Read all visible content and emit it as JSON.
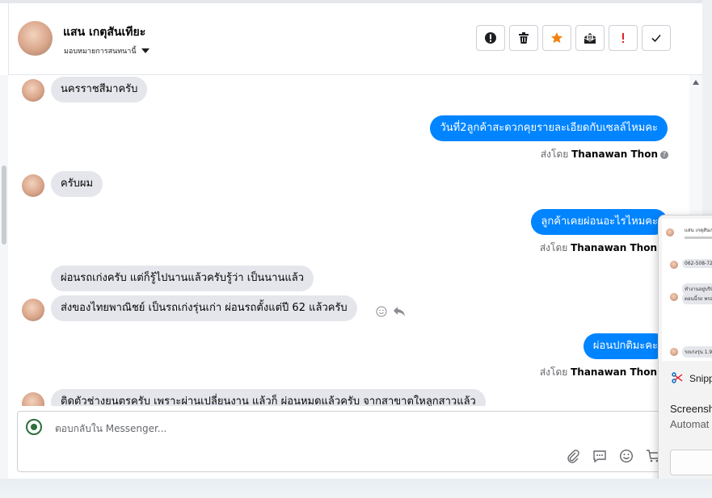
{
  "header": {
    "contact_name": "แสน เกตุสันเทียะ",
    "assign_label": "มอบหมายการสนทนานี้",
    "actions": [
      {
        "name": "mark-spam-button",
        "icon": "exclamation-circle-icon"
      },
      {
        "name": "delete-button",
        "icon": "trash-icon"
      },
      {
        "name": "star-button",
        "icon": "star-icon"
      },
      {
        "name": "mark-unread-button",
        "icon": "envelope-open-icon"
      },
      {
        "name": "follow-up-button",
        "icon": "exclamation-icon"
      },
      {
        "name": "mark-done-button",
        "icon": "checkmark-icon"
      }
    ]
  },
  "messages": [
    {
      "dir": "in",
      "text": "นครราชสีมาครับ"
    },
    {
      "dir": "out",
      "text": "วันที่2ลูกค้าสะดวกคุยรายละเอียดกับเซลล์ไหมคะ",
      "sent_prefix": "ส่งโดย",
      "sender": "Thanawan Thon"
    },
    {
      "dir": "in",
      "text": "ครับผม"
    },
    {
      "dir": "out",
      "text": "ลูกค้าเคยผ่อนอะไรไหมคะ",
      "sent_prefix": "ส่งโดย",
      "sender": "Thanawan Thon"
    },
    {
      "dir": "in",
      "text": "ผ่อนรถเก่งครับ แต่ก็รู้ไปนานแล้วครับรู้ว่า เป็นนานแล้ว"
    },
    {
      "dir": "in",
      "text": "ส่งของไทยพาณิชย์ เป็นรถเก่งรุ่นเก่า ผ่อนรถตั้งแต่ปี 62 แล้วครับ"
    },
    {
      "dir": "out",
      "text": "ผ่อนปกติมะคะ",
      "sent_prefix": "ส่งโดย",
      "sender": "Thanawan Thon"
    },
    {
      "dir": "in",
      "text": "ติดตัวช่างยนตรครับ เพราะผ่านเปลี่ยนงาน แล้วก็ ผ่อนหมดแล้วครับ จากสาขาตใหลูกสาวแล้ว"
    }
  ],
  "composer": {
    "placeholder": "ตอบกลับใน Messenger..."
  },
  "snip_popup": {
    "app_name": "Snipp",
    "line1": "Screensh",
    "line2": "Automat",
    "thumb_texts": [
      "แสน เกตุสันเทีย",
      "062-508-7206",
      "ทำงานอยู่บริษัท",
      "ตอนนี้รถ พรอ",
      "รถเก่งรุ่น 1.9"
    ]
  },
  "colors": {
    "accent": "#0084ff",
    "incoming_bubble": "#e4e6eb",
    "star": "#f0820f",
    "follow_up": "#e02020"
  }
}
